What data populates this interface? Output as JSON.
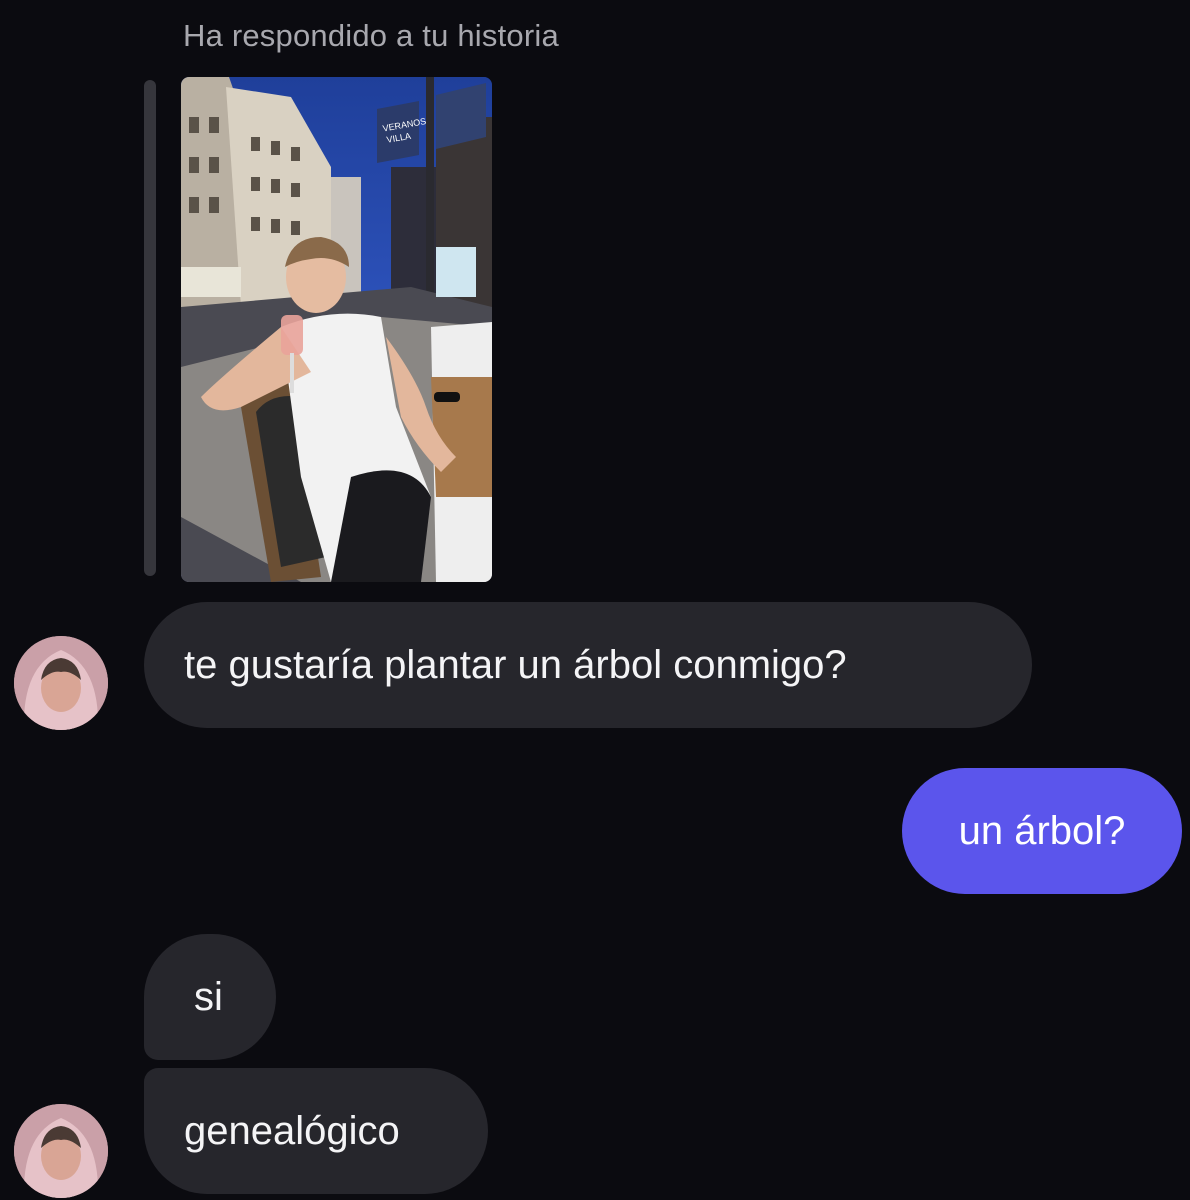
{
  "story_reply": {
    "caption": "Ha respondido a tu historia",
    "photo": {
      "subject": "story-photo",
      "banner_text": "VERANOS VILLA"
    }
  },
  "messages": [
    {
      "sender": "them",
      "text": "te gustaría plantar un árbol conmigo?"
    },
    {
      "sender": "me",
      "text": "un árbol?"
    },
    {
      "sender": "them",
      "text": "si"
    },
    {
      "sender": "them",
      "text": "genealógico"
    }
  ],
  "colors": {
    "background": "#0b0b10",
    "incoming_bubble": "#26262c",
    "outgoing_bubble": "#5b55ec",
    "caption_text": "#a8a8ae"
  }
}
